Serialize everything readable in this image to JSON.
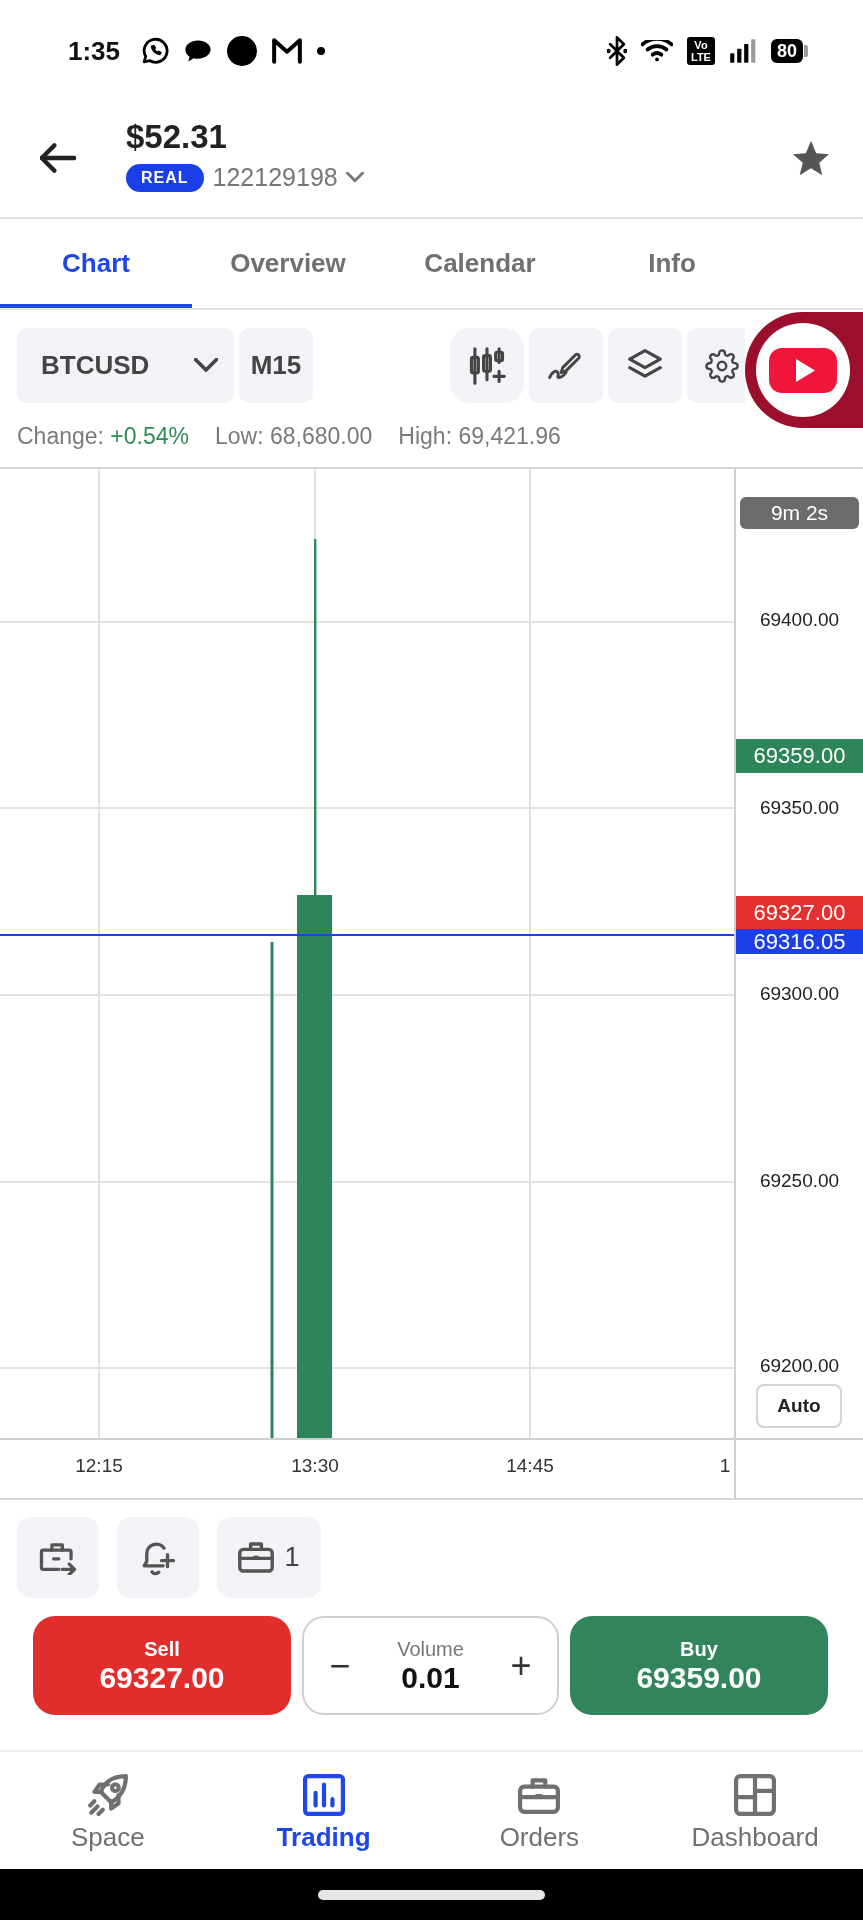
{
  "status_bar": {
    "time": "1:35",
    "network_label": [
      "Vo",
      "LTE"
    ],
    "battery": "80"
  },
  "header": {
    "balance": "$52.31",
    "account_type": "REAL",
    "account_number": "122129198"
  },
  "tabs": [
    {
      "label": "Chart",
      "selected": true
    },
    {
      "label": "Overview",
      "selected": false
    },
    {
      "label": "Calendar",
      "selected": false
    },
    {
      "label": "Info",
      "selected": false
    }
  ],
  "toolbar": {
    "symbol": "BTCUSD",
    "timeframe": "M15"
  },
  "stats": [
    {
      "label": "Change:",
      "value": "+0.54%",
      "kind": "change"
    },
    {
      "label": "Low:",
      "value": "68,680.00",
      "kind": "price"
    },
    {
      "label": "High:",
      "value": "69,421.96",
      "kind": "price"
    }
  ],
  "chart": {
    "countdown": "9m 2s",
    "price_axis": [
      "69400.00",
      "69350.00",
      "69300.00",
      "69250.00",
      "69200.00"
    ],
    "price_tags": [
      {
        "label": "69359.00",
        "color": "#2e8559"
      },
      {
        "label": "69327.00",
        "color": "#e2312f"
      },
      {
        "label": "69316.05",
        "color": "#1f3fe6"
      }
    ],
    "auto_button": "Auto",
    "time_axis": [
      "12:15",
      "13:30",
      "14:45",
      "1"
    ]
  },
  "quick_actions": {
    "positions_count": "1"
  },
  "trade": {
    "sell": {
      "label": "Sell",
      "price": "69327.00"
    },
    "volume": {
      "decrement": "−",
      "label": "Volume",
      "value": "0.01",
      "increment": "+"
    },
    "buy": {
      "label": "Buy",
      "price": "69359.00"
    }
  },
  "bottom_nav": [
    {
      "label": "Space",
      "selected": false
    },
    {
      "label": "Trading",
      "selected": true
    },
    {
      "label": "Orders",
      "selected": false
    },
    {
      "label": "Dashboard",
      "selected": false
    }
  ]
}
